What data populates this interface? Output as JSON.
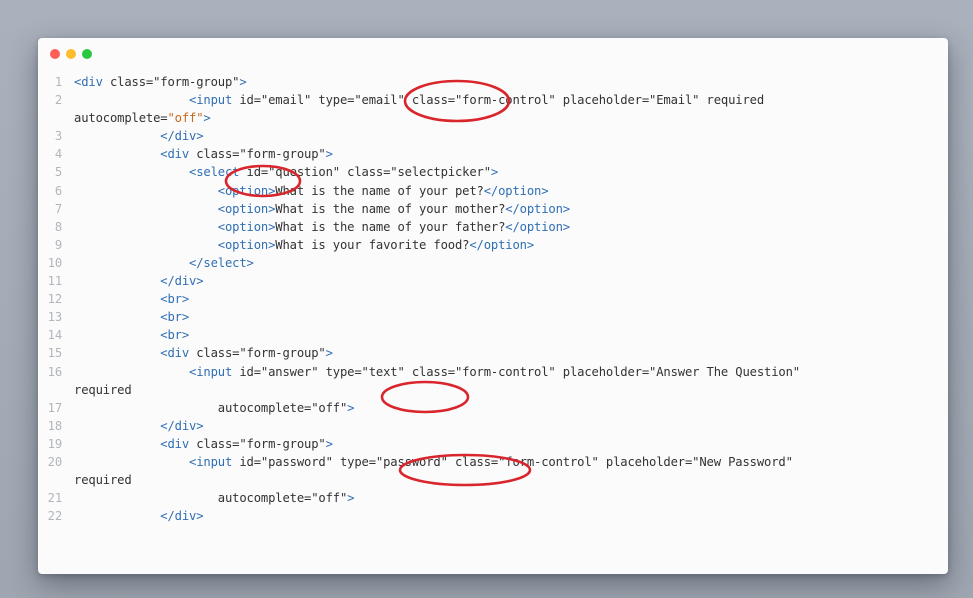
{
  "window": {
    "controls": [
      {
        "name": "close",
        "color": "#ff5f57"
      },
      {
        "name": "minimize",
        "color": "#febc2e"
      },
      {
        "name": "maximize",
        "color": "#28c840"
      }
    ]
  },
  "code": {
    "lines": [
      {
        "n": "1",
        "text": "<div class=\"form-group\">"
      },
      {
        "n": "2",
        "text": "                <input id=\"email\" type=\"email\" class=\"form-control\" placeholder=\"Email\" required"
      },
      {
        "n": "",
        "text": "autocomplete=\"off\">"
      },
      {
        "n": "3",
        "text": "            </div>"
      },
      {
        "n": "4",
        "text": "            <div class=\"form-group\">"
      },
      {
        "n": "5",
        "text": "                <select id=\"question\" class=\"selectpicker\">"
      },
      {
        "n": "6",
        "text": "                    <option>What is the name of your pet?</option>"
      },
      {
        "n": "7",
        "text": "                    <option>What is the name of your mother?</option>"
      },
      {
        "n": "8",
        "text": "                    <option>What is the name of your father?</option>"
      },
      {
        "n": "9",
        "text": "                    <option>What is your favorite food?</option>"
      },
      {
        "n": "10",
        "text": "                </select>"
      },
      {
        "n": "11",
        "text": "            </div>"
      },
      {
        "n": "12",
        "text": "            <br>"
      },
      {
        "n": "13",
        "text": "            <br>"
      },
      {
        "n": "14",
        "text": "            <br>"
      },
      {
        "n": "15",
        "text": "            <div class=\"form-group\">"
      },
      {
        "n": "16",
        "text": "                <input id=\"answer\" type=\"text\" class=\"form-control\" placeholder=\"Answer The Question\""
      },
      {
        "n": "",
        "text": "required"
      },
      {
        "n": "17",
        "text": "                    autocomplete=\"off\">"
      },
      {
        "n": "18",
        "text": "            </div>"
      },
      {
        "n": "19",
        "text": "            <div class=\"form-group\">"
      },
      {
        "n": "20",
        "text": "                <input id=\"password\" type=\"password\" class=\"form-control\" placeholder=\"New Password\""
      },
      {
        "n": "",
        "text": "required"
      },
      {
        "n": "21",
        "text": "                    autocomplete=\"off\">"
      },
      {
        "n": "22",
        "text": "            </div>"
      }
    ]
  },
  "annotations": {
    "color": "#d9262c",
    "highlights": [
      "type=\"email\"",
      "<select",
      "type=\"text\"",
      "type=\"password\""
    ]
  }
}
